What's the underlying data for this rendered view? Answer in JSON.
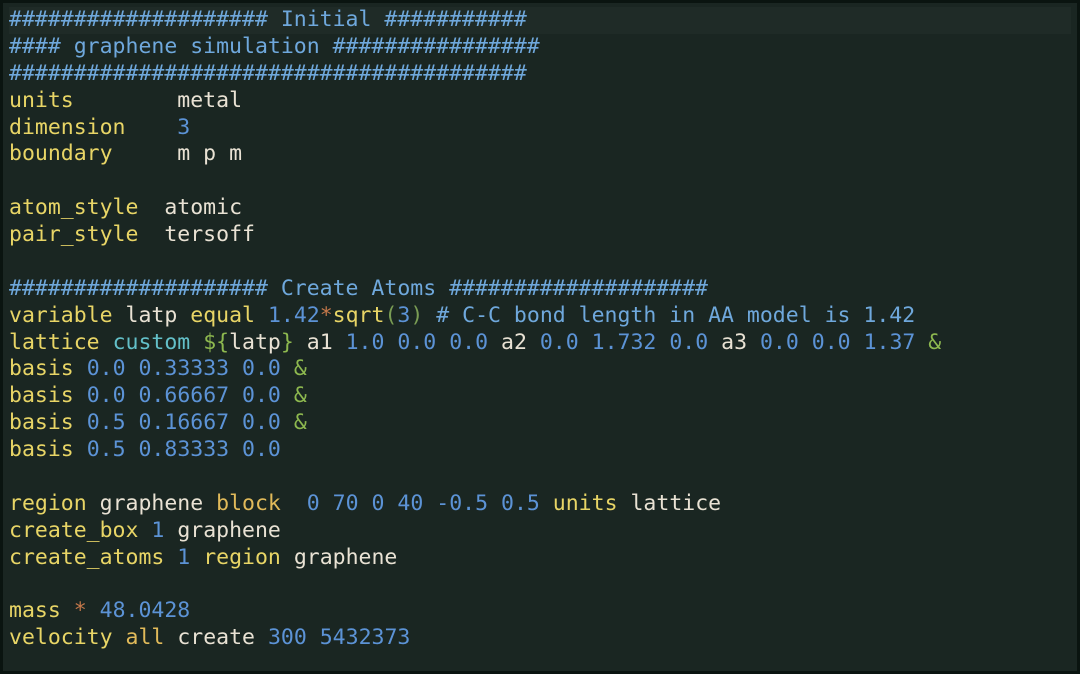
{
  "comments": {
    "initial": "#################### Initial ###########",
    "graphene_sim": "#### graphene simulation ################",
    "hashline": "########################################",
    "create_atoms": "#################### Create Atoms ####################",
    "bond_comment": "# C-C bond length in AA model is 1.42"
  },
  "kw": {
    "units": "units",
    "dimension": "dimension",
    "boundary": "boundary",
    "atom_style": "atom_style",
    "pair_style": "pair_style",
    "variable": "variable",
    "lattice": "lattice",
    "basis": "basis",
    "region": "region",
    "create_box": "create_box",
    "create_atoms": "create_atoms",
    "mass": "mass",
    "velocity": "velocity",
    "sqrt": "sqrt",
    "equal": "equal"
  },
  "val": {
    "units_metal": "metal",
    "dimension_3": "3",
    "boundary_mpm": "m p m",
    "atomic": "atomic",
    "tersoff": "tersoff",
    "latp": "latp",
    "custom": "custom",
    "latpvar": "latp",
    "a1": "a1",
    "a2": "a2",
    "a3": "a3",
    "graphene": "graphene",
    "block": "block",
    "units_sub": "units",
    "lattice_sub": "lattice",
    "all": "all",
    "create": "create",
    "region_sub": "region",
    "one": "1"
  },
  "num": {
    "n1_42": "1.42",
    "n3": "3",
    "n1_0": "1.0",
    "n0_0": "0.0",
    "n1_732": "1.732",
    "n1_37": "1.37",
    "n0_33333": "0.33333",
    "n0_66667": "0.66667",
    "n0_5": "0.5",
    "n0_16667": "0.16667",
    "n0_83333": "0.83333",
    "n0": "0",
    "n70": "70",
    "n40": "40",
    "nm0_5": "-0.5",
    "np0_5": "0.5",
    "n48_0428": "48.0428",
    "n300": "300",
    "n5432373": "5432373"
  },
  "sym": {
    "star": "*",
    "amp": "&",
    "dol_open": "${",
    "dol_close": "}",
    "lpar": "(",
    "rpar": ")"
  }
}
